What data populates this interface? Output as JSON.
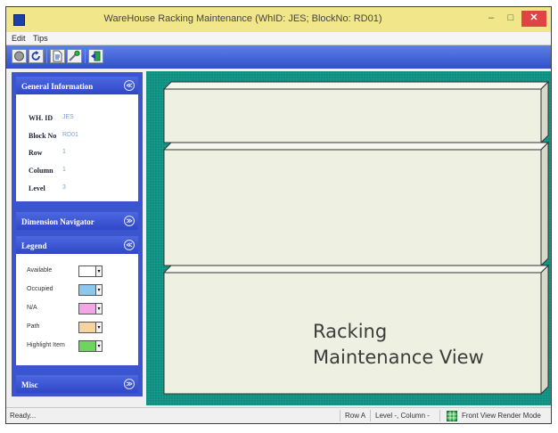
{
  "window": {
    "title": "WareHouse Racking Maintenance (WhID: JES; BlockNo: RD01)",
    "controls": {
      "minimize": "–",
      "maximize": "□",
      "close": "✕"
    }
  },
  "menu": [
    {
      "label": "Edit"
    },
    {
      "label": "Tips"
    }
  ],
  "toolbar": {
    "buttons": [
      {
        "name": "stop-icon"
      },
      {
        "name": "refresh-icon"
      },
      {
        "name": "document-icon"
      },
      {
        "name": "tools-icon"
      },
      {
        "name": "exit-icon"
      }
    ]
  },
  "sidebar": {
    "general": {
      "title": "General Information",
      "fields": [
        {
          "label": "WH. ID",
          "value": "JES"
        },
        {
          "label": "Block No",
          "value": "RD01"
        },
        {
          "label": "Row",
          "value": "1"
        },
        {
          "label": "Column",
          "value": "1"
        },
        {
          "label": "Level",
          "value": "3"
        }
      ]
    },
    "dimension": {
      "title": "Dimension Navigator"
    },
    "legend": {
      "title": "Legend",
      "items": [
        {
          "label": "Available",
          "color": "#ffffff"
        },
        {
          "label": "Occupied",
          "color": "#8cc8ec"
        },
        {
          "label": "N/A",
          "color": "#f2a6e6"
        },
        {
          "label": "Path",
          "color": "#f6d4a2"
        },
        {
          "label": "Highlight Item",
          "color": "#6fd35f"
        }
      ]
    },
    "misc": {
      "title": "Misc"
    },
    "collapse_glyph": "≪",
    "expand_glyph": "≫",
    "dropdown_glyph": "▾"
  },
  "viewport": {
    "title_line1": "Racking",
    "title_line2": "Maintenance View",
    "shelf_color": "#eef0e2",
    "background": "#0a8f80"
  },
  "status": {
    "left": "Ready...",
    "row": "Row A",
    "level_column": "Level -, Column -",
    "render_mode": "Front View Render Mode"
  }
}
